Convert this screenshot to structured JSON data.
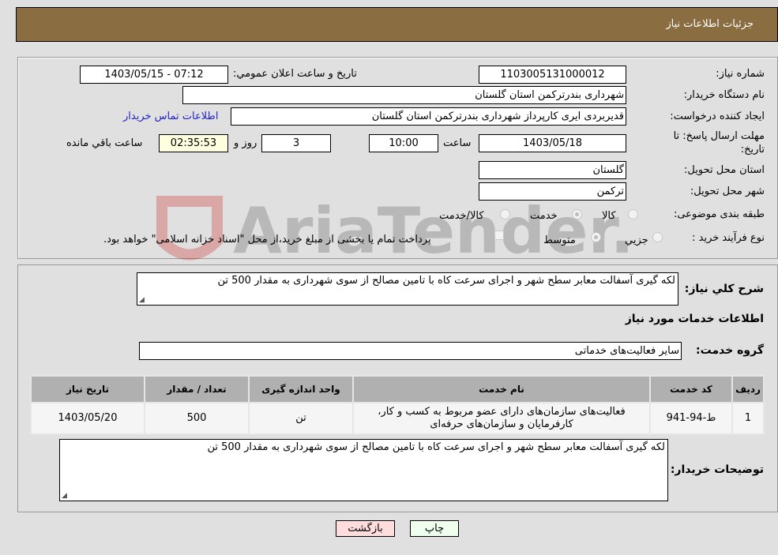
{
  "header": {
    "title": "جزئیات اطلاعات نیاز"
  },
  "form": {
    "need_number": {
      "label": "شماره نیاز:",
      "value": "1103005131000012"
    },
    "announce_datetime": {
      "label": "تاریخ و ساعت اعلان عمومي:",
      "value": "1403/05/15 - 07:12"
    },
    "buyer_org": {
      "label": "نام دستگاه خريدار:",
      "value": "شهرداری بندرترکمن استان گلستان"
    },
    "requester": {
      "label": "ایجاد کننده درخواست:",
      "value": "قدیربردی ایری کارپرداز شهرداری بندرترکمن استان گلستان",
      "contact_link": "اطلاعات تماس خریدار"
    },
    "deadline": {
      "label_line1": "مهلت ارسال پاسخ: تا",
      "label_line2": "تاريخ:",
      "date": "1403/05/18",
      "time_label": "ساعت",
      "time": "10:00",
      "days": "3",
      "days_label": "روز و",
      "remaining": "02:35:53",
      "remaining_label": "ساعت باقي مانده"
    },
    "delivery_province": {
      "label": "استان محل تحویل:",
      "value": "گلستان"
    },
    "delivery_city": {
      "label": "شهر محل تحویل:",
      "value": "ترکمن"
    },
    "category": {
      "label": "طبقه بندی موضوعی:",
      "options": [
        "کالا",
        "خدمت",
        "کالا/خدمت"
      ],
      "selected": "خدمت"
    },
    "purchase_type": {
      "label": "نوع فرآیند خرید :",
      "options": [
        "جزيي",
        "متوسط"
      ],
      "selected": "متوسط",
      "treasury_note": "پرداخت تمام یا بخشی از مبلغ خرید،از محل \"اسناد خزانه اسلامی\" خواهد بود.",
      "treasury_checked": false
    }
  },
  "details": {
    "general_desc_label": "شرح كلي نياز:",
    "general_desc": "لکه گیری آسفالت معابر سطح شهر و اجرای سرعت کاه با تامین مصالح از سوی شهرداری به مقدار 500 تن",
    "services_title": "اطلاعات خدمات مورد نياز",
    "service_group_label": "گروه خدمت:",
    "service_group": "سایر فعالیت‌های خدماتی",
    "table": {
      "headers": [
        "رديف",
        "کد خدمت",
        "نام خدمت",
        "واحد اندازه گیری",
        "تعداد / مقدار",
        "تاریخ نیاز"
      ],
      "rows": [
        {
          "index": "1",
          "code": "ط-94-941",
          "name_line1": "فعالیت‌های سازمان‌های دارای عضو مربوط به کسب و کار،",
          "name_line2": "کارفرمایان و سازمان‌های حرفه‌ای",
          "unit": "تن",
          "quantity": "500",
          "date": "1403/05/20"
        }
      ]
    },
    "buyer_notes_label": "توضیحات خریدار:",
    "buyer_notes": "لکه گیری آسفالت معابر سطح شهر و اجرای سرعت کاه با تامین مصالح از سوی شهرداری به مقدار 500 تن"
  },
  "buttons": {
    "print": "چاپ",
    "back": "بازگشت"
  },
  "watermark": {
    "text": "AriaTender.neT"
  }
}
